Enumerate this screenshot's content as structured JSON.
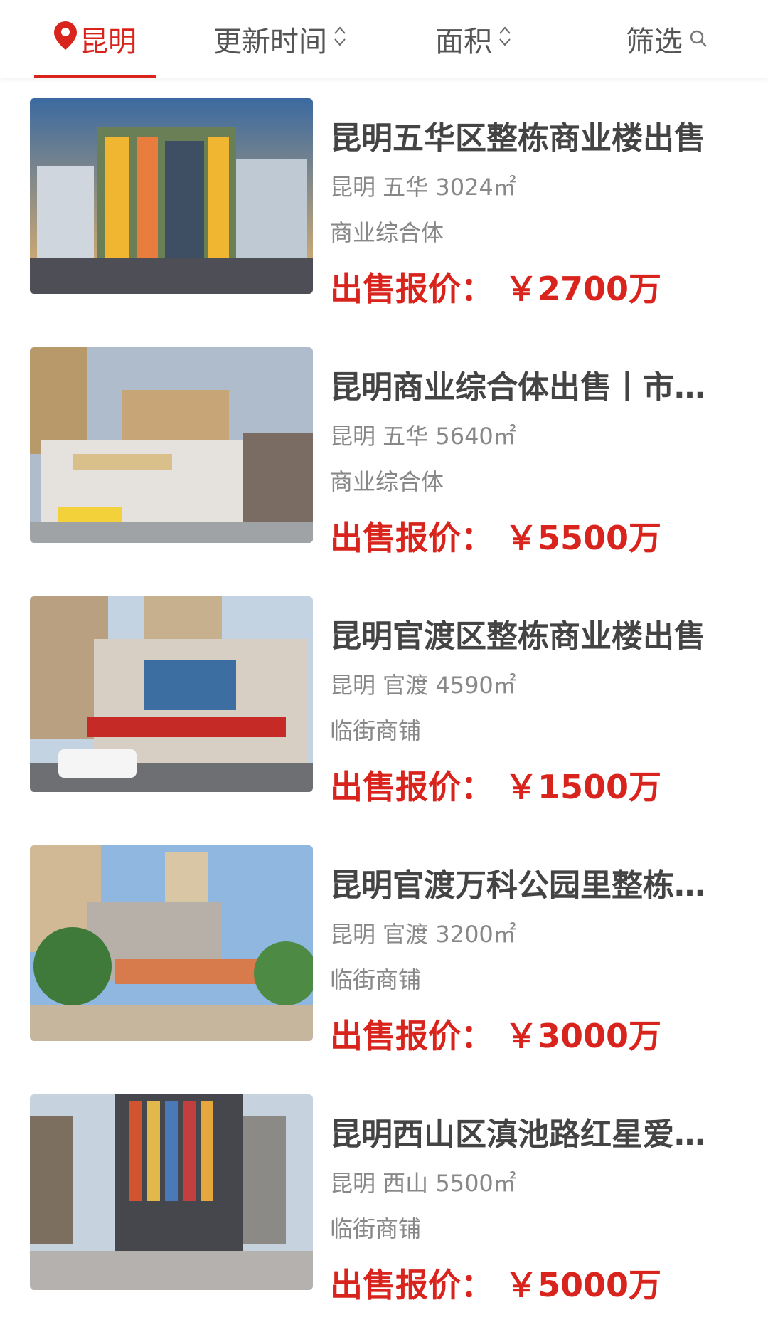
{
  "topbar": {
    "city": "昆明",
    "sort_update": "更新时间",
    "sort_area": "面积",
    "filter": "筛选",
    "accent_color": "#d8241c",
    "icons": {
      "city": "location-pin-icon",
      "sort": "sort-updown-icon",
      "filter": "search-icon"
    }
  },
  "listings": [
    {
      "title": "昆明五华区整栋商业楼出售",
      "meta": "昆明 五华 3024㎡",
      "type": "商业综合体",
      "price_label": "出售报价：",
      "price": "￥2700万"
    },
    {
      "title": "昆明商业综合体出售丨市中心",
      "meta": "昆明 五华 5640㎡",
      "type": "商业综合体",
      "price_label": "出售报价：",
      "price": "￥5500万"
    },
    {
      "title": "昆明官渡区整栋商业楼出售",
      "meta": "昆明 官渡 4590㎡",
      "type": "临街商铺",
      "price_label": "出售报价：",
      "price": "￥1500万"
    },
    {
      "title": "昆明官渡万科公园里整栋商业",
      "meta": "昆明 官渡 3200㎡",
      "type": "临街商铺",
      "price_label": "出售报价：",
      "price": "￥3000万"
    },
    {
      "title": "昆明西山区滇池路红星爱琴海",
      "meta": "昆明 西山 5500㎡",
      "type": "临街商铺",
      "price_label": "出售报价：",
      "price": "￥5000万"
    }
  ]
}
